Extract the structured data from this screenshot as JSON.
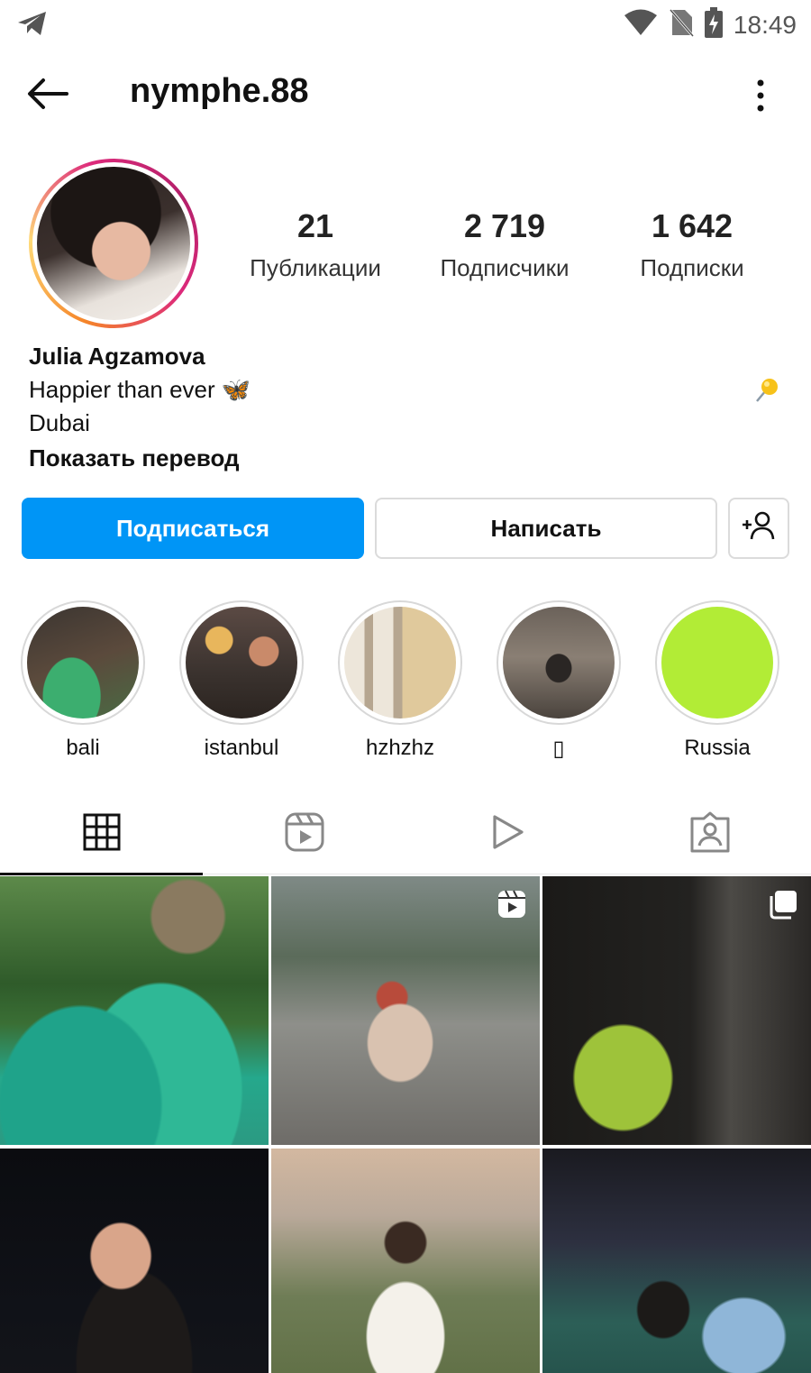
{
  "status_bar": {
    "time": "18:49"
  },
  "header": {
    "username": "nymphe.88"
  },
  "profile": {
    "stats": [
      {
        "value": "21",
        "label": "Публикации"
      },
      {
        "value": "2 719",
        "label": "Подписчики"
      },
      {
        "value": "1 642",
        "label": "Подписки"
      }
    ],
    "full_name": "Julia Agzamova",
    "bio_line_1": "Happier than ever 🦋",
    "bio_line_2": "Dubai",
    "show_translation": "Показать перевод"
  },
  "actions": {
    "follow_label": "Подписаться",
    "message_label": "Написать"
  },
  "highlights": [
    {
      "label": "bali"
    },
    {
      "label": "istanbul"
    },
    {
      "label": "hzhzhz"
    },
    {
      "label": "▯"
    },
    {
      "label": "Russia"
    }
  ],
  "tabs": [
    "grid-icon",
    "reels-icon",
    "video-icon",
    "tagged-icon"
  ],
  "colors": {
    "primary": "#0095f6",
    "border": "#dbdbdb",
    "highlight_green": "#b2ec36"
  }
}
